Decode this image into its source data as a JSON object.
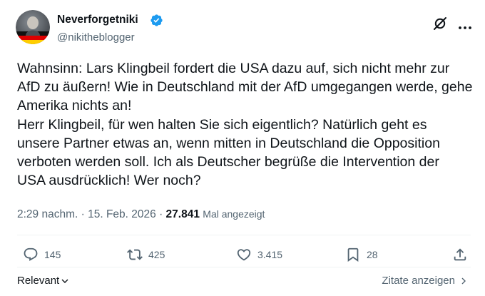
{
  "author": {
    "name": "Neverforgetniki",
    "handle": "@nikitheblogger",
    "verified": true,
    "badge_color": "#1d9bf0"
  },
  "tweet": {
    "text": "Wahnsinn: Lars Klingbeil fordert die USA dazu auf, sich nicht mehr zur\nAfD zu äußern! Wie in Deutschland mit der AfD umgegangen werde, gehe\nAmerika nichts an!\nHerr Klingbeil, für wen halten Sie sich eigentlich? Natürlich geht es\nunsere Partner etwas an, wenn mitten in Deutschland die Opposition\nverboten werden soll. Ich als Deutscher begrüße die Intervention der\nUSA ausdrücklich! Wer noch?"
  },
  "meta": {
    "time": "2:29 nachm.",
    "separator": " · ",
    "date": "15. Feb. 2026",
    "views_count": "27.841",
    "views_label": "Mal angezeigt"
  },
  "actions": {
    "replies": "145",
    "reposts": "425",
    "likes": "3.415",
    "bookmarks": "28"
  },
  "footer": {
    "sort_label": "Relevant",
    "quotes_label": "Zitate anzeigen"
  },
  "icons": {
    "grok": "grok-icon",
    "more": "more-icon",
    "reply": "reply-icon",
    "repost": "repost-icon",
    "like": "heart-icon",
    "bookmark": "bookmark-icon",
    "share": "share-icon"
  },
  "colors": {
    "text": "#0f1419",
    "secondary": "#536471",
    "divider": "#eff3f4",
    "accent": "#1d9bf0"
  }
}
